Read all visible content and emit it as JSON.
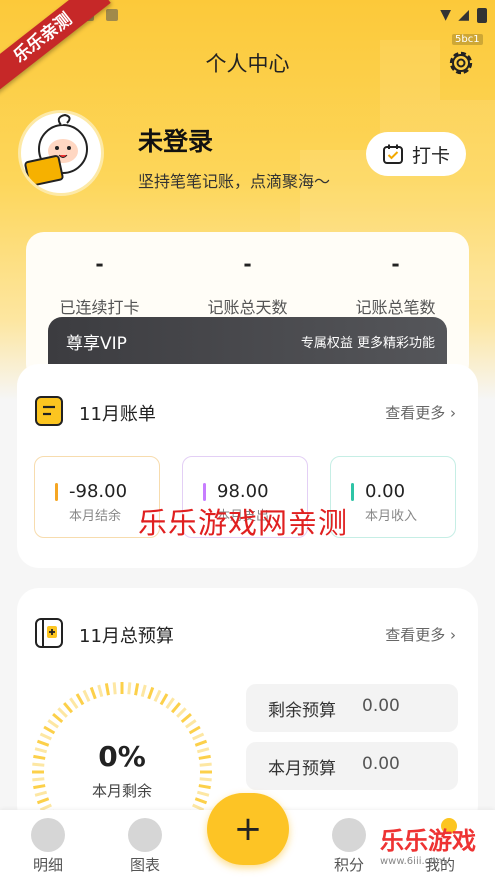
{
  "ribbon_text": "乐乐亲测",
  "header": {
    "title": "个人中心",
    "version_badge": "5bc1"
  },
  "profile": {
    "username": "未登录",
    "slogan": "坚持笔笔记账，点滴聚海～",
    "checkin_label": "打卡"
  },
  "stats": [
    {
      "value": "-",
      "label": "已连续打卡"
    },
    {
      "value": "-",
      "label": "记账总天数"
    },
    {
      "value": "-",
      "label": "记账总笔数"
    }
  ],
  "vip": {
    "title": "尊享VIP",
    "desc": "专属权益 更多精彩功能"
  },
  "bill_card": {
    "title": "11月账单",
    "more": "查看更多",
    "items": [
      {
        "value": "-98.00",
        "label": "本月结余",
        "color": "#f5a623"
      },
      {
        "value": "98.00",
        "label": "本月支出",
        "color": "#c77dff"
      },
      {
        "value": "0.00",
        "label": "本月收入",
        "color": "#2ec4a6"
      }
    ]
  },
  "watermark": "乐乐游戏网亲测",
  "budget_card": {
    "title": "11月总预算",
    "more": "查看更多",
    "remaining_pct": "0%",
    "remaining_label": "本月剩余",
    "rows": [
      {
        "label": "剩余预算",
        "value": "0.00"
      },
      {
        "label": "本月预算",
        "value": "0.00"
      }
    ]
  },
  "tabbar": {
    "items": [
      {
        "label": "明细",
        "icon": "ledger-icon"
      },
      {
        "label": "图表",
        "icon": "chart-icon"
      },
      {
        "label": "积分",
        "icon": "star-icon"
      },
      {
        "label": "我的",
        "icon": "profile-icon"
      }
    ],
    "fab_label": "+"
  },
  "corner_logo": {
    "text": "乐乐游戏",
    "url": "www.6iii.com"
  },
  "colors": {
    "accent": "#fdc425",
    "hero": "#fcc93a",
    "watermark": "#e02020"
  }
}
